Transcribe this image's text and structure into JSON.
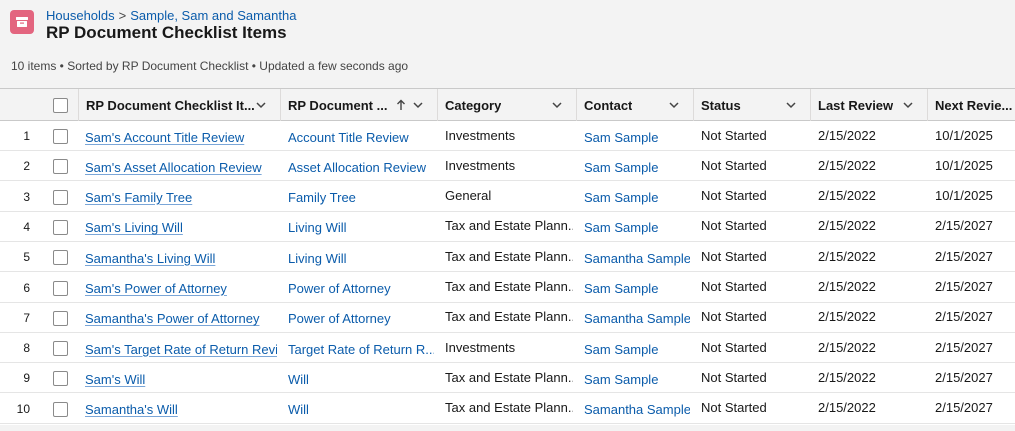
{
  "breadcrumb": {
    "parent": "Households",
    "separator": ">",
    "record": "Sample, Sam and Samantha"
  },
  "title": "RP Document Checklist Items",
  "meta": "10 items • Sorted by RP Document Checklist • Updated a few seconds ago",
  "colors": {
    "accent": "#0b5cab",
    "icon_bg": "#e3657f",
    "header_bg": "#f3f3f3"
  },
  "icons": {
    "object": "list-icon",
    "sort": "arrow-up-icon",
    "column_menu": "chevron-down-icon"
  },
  "columns": [
    {
      "label": "RP Document Checklist It..."
    },
    {
      "label": "RP Document ..."
    },
    {
      "label": "Category"
    },
    {
      "label": "Contact"
    },
    {
      "label": "Status"
    },
    {
      "label": "Last Review"
    },
    {
      "label": "Next Revie..."
    }
  ],
  "rows": [
    {
      "num": "1",
      "item": "Sam's Account Title Review",
      "document": "Account Title Review",
      "category": "Investments",
      "contact": "Sam Sample",
      "status": "Not Started",
      "last_review": "2/15/2022",
      "next_review": "10/1/2025"
    },
    {
      "num": "2",
      "item": "Sam's Asset Allocation Review",
      "document": "Asset Allocation Review",
      "category": "Investments",
      "contact": "Sam Sample",
      "status": "Not Started",
      "last_review": "2/15/2022",
      "next_review": "10/1/2025"
    },
    {
      "num": "3",
      "item": "Sam's Family Tree",
      "document": "Family Tree",
      "category": "General",
      "contact": "Sam Sample",
      "status": "Not Started",
      "last_review": "2/15/2022",
      "next_review": "10/1/2025"
    },
    {
      "num": "4",
      "item": "Sam's Living Will",
      "document": "Living Will",
      "category": "Tax and Estate Plann...",
      "contact": "Sam Sample",
      "status": "Not Started",
      "last_review": "2/15/2022",
      "next_review": "2/15/2027"
    },
    {
      "num": "5",
      "item": "Samantha's Living Will",
      "document": "Living Will",
      "category": "Tax and Estate Plann...",
      "contact": "Samantha Sample",
      "status": "Not Started",
      "last_review": "2/15/2022",
      "next_review": "2/15/2027"
    },
    {
      "num": "6",
      "item": "Sam's Power of Attorney",
      "document": "Power of Attorney",
      "category": "Tax and Estate Plann...",
      "contact": "Sam Sample",
      "status": "Not Started",
      "last_review": "2/15/2022",
      "next_review": "2/15/2027"
    },
    {
      "num": "7",
      "item": "Samantha's Power of Attorney",
      "document": "Power of Attorney",
      "category": "Tax and Estate Plann...",
      "contact": "Samantha Sample",
      "status": "Not Started",
      "last_review": "2/15/2022",
      "next_review": "2/15/2027"
    },
    {
      "num": "8",
      "item": "Sam's Target Rate of Return Revie",
      "document": "Target Rate of Return R...",
      "category": "Investments",
      "contact": "Sam Sample",
      "status": "Not Started",
      "last_review": "2/15/2022",
      "next_review": "2/15/2027"
    },
    {
      "num": "9",
      "item": "Sam's Will",
      "document": "Will",
      "category": "Tax and Estate Plann...",
      "contact": "Sam Sample",
      "status": "Not Started",
      "last_review": "2/15/2022",
      "next_review": "2/15/2027"
    },
    {
      "num": "10",
      "item": "Samantha's Will",
      "document": "Will",
      "category": "Tax and Estate Plann...",
      "contact": "Samantha Sample",
      "status": "Not Started",
      "last_review": "2/15/2022",
      "next_review": "2/15/2027"
    }
  ]
}
